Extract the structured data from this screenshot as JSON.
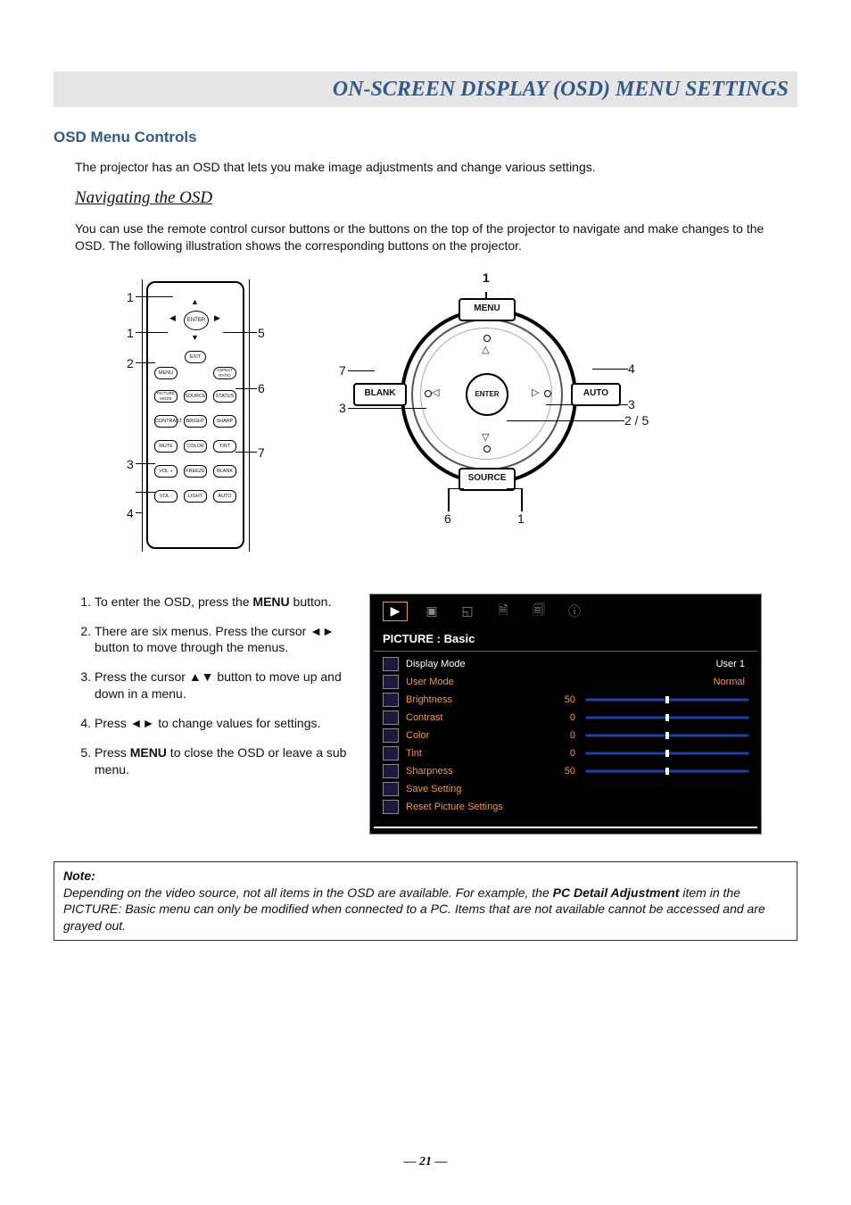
{
  "banner_title": "ON-SCREEN DISPLAY (OSD) MENU SETTINGS",
  "section_heading": "OSD Menu Controls",
  "intro_p": "The projector has an OSD that lets you make image adjustments and change various settings.",
  "sub_heading": "Navigating the OSD",
  "nav_p": "You can use the remote control cursor buttons or the buttons on the top of the projector to navigate and make changes to the OSD. The following illustration shows the corresponding buttons on the projector.",
  "remote": {
    "enter": "ENTER",
    "exit": "EXIT",
    "menu": "MENU",
    "aspect": "ASPECT RATIO",
    "row1": [
      "PICTURE MODE",
      "SOURCE",
      "STATUS"
    ],
    "row2": [
      "CONTRAST",
      "BRIGHT",
      "SHARP"
    ],
    "row3": [
      "MUTE",
      "COLOR",
      "TINT"
    ],
    "row4": [
      "VOL +",
      "FREEZE",
      "BLANK"
    ],
    "row5": [
      "VOL -",
      "LIGHT",
      "AUTO"
    ],
    "callouts": {
      "c1": "1",
      "c1b": "1",
      "c2": "2",
      "c3": "3",
      "c4": "4",
      "c5": "5",
      "c6": "6",
      "c7": "7"
    }
  },
  "panel": {
    "menu": "MENU",
    "blank": "BLANK",
    "enter": "ENTER",
    "auto": "AUTO",
    "source": "SOURCE",
    "callouts": {
      "c1": "1",
      "c1b": "1",
      "c2_5": "2 / 5",
      "c3": "3",
      "c3b": "3",
      "c4": "4",
      "c6": "6",
      "c7": "7"
    }
  },
  "steps": [
    {
      "pre": "To enter the OSD, press the ",
      "bold": "MENU",
      "post": " button."
    },
    {
      "text": "There are six menus. Press the cursor ◄► button to move through the menus."
    },
    {
      "text": "Press the cursor ▲▼ button to move up and down in a menu."
    },
    {
      "text": "Press ◄► to change values for settings."
    },
    {
      "pre": "Press ",
      "bold": "MENU",
      "post": " to close the OSD or leave a sub menu."
    }
  ],
  "osd": {
    "title": "PICTURE : Basic",
    "rows": [
      {
        "label": "Display Mode",
        "type": "text",
        "value": "User 1",
        "selected": true
      },
      {
        "label": "User Mode",
        "type": "text",
        "value": "Normal"
      },
      {
        "label": "Brightness",
        "type": "slider",
        "value": 50,
        "min": 0,
        "max": 100
      },
      {
        "label": "Contrast",
        "type": "slider",
        "value": 0,
        "min": -50,
        "max": 50
      },
      {
        "label": "Color",
        "type": "slider",
        "value": 0,
        "min": -50,
        "max": 50
      },
      {
        "label": "Tint",
        "type": "slider",
        "value": 0,
        "min": -50,
        "max": 50
      },
      {
        "label": "Sharpness",
        "type": "slider",
        "value": 50,
        "min": 0,
        "max": 100
      },
      {
        "label": "Save Setting",
        "type": "action"
      },
      {
        "label": "Reset Picture Settings",
        "type": "action"
      }
    ]
  },
  "note": {
    "heading": "Note:",
    "pre": "Depending on the video source, not all items in the OSD are available. For example, the ",
    "bold": "PC Detail Adjustment",
    "post": " item in the PICTURE: Basic menu can only be modified when connected to a PC. Items that are not available cannot be accessed and are grayed out."
  },
  "page_number": "— 21 —"
}
